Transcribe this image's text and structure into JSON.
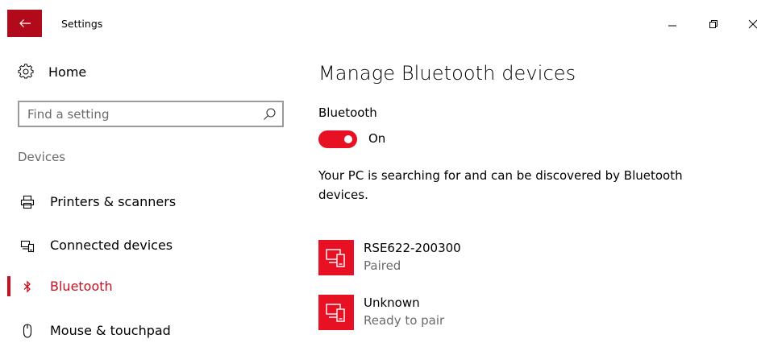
{
  "window": {
    "title": "Settings",
    "back_icon": "arrow-left-icon",
    "controls": [
      "minimize-icon",
      "restore-icon",
      "close-icon"
    ]
  },
  "sidebar": {
    "home": {
      "label": "Home",
      "icon": "gear-icon"
    },
    "search": {
      "placeholder": "Find a setting",
      "value": "",
      "icon": "search-icon"
    },
    "section_header": "Devices",
    "items": [
      {
        "label": "Printers & scanners",
        "icon": "printer-icon",
        "active": false
      },
      {
        "label": "Connected devices",
        "icon": "connected-devices-icon",
        "active": false
      },
      {
        "label": "Bluetooth",
        "icon": "bluetooth-icon",
        "active": true
      },
      {
        "label": "Mouse & touchpad",
        "icon": "mouse-icon",
        "active": false
      }
    ]
  },
  "main": {
    "title": "Manage Bluetooth devices",
    "bluetooth_label": "Bluetooth",
    "toggle": {
      "state": "On",
      "on": true
    },
    "status_text": "Your PC is searching for and can be discovered by Bluetooth devices.",
    "devices": [
      {
        "name": "RSE622-200300",
        "status": "Paired",
        "icon": "device-icon"
      },
      {
        "name": "Unknown",
        "status": "Ready to pair",
        "icon": "device-icon"
      }
    ]
  },
  "colors": {
    "accent": "#e81123",
    "back_button": "#b10a1a",
    "active_nav": "#c50f1f",
    "secondary_text": "#6b6b6b"
  }
}
